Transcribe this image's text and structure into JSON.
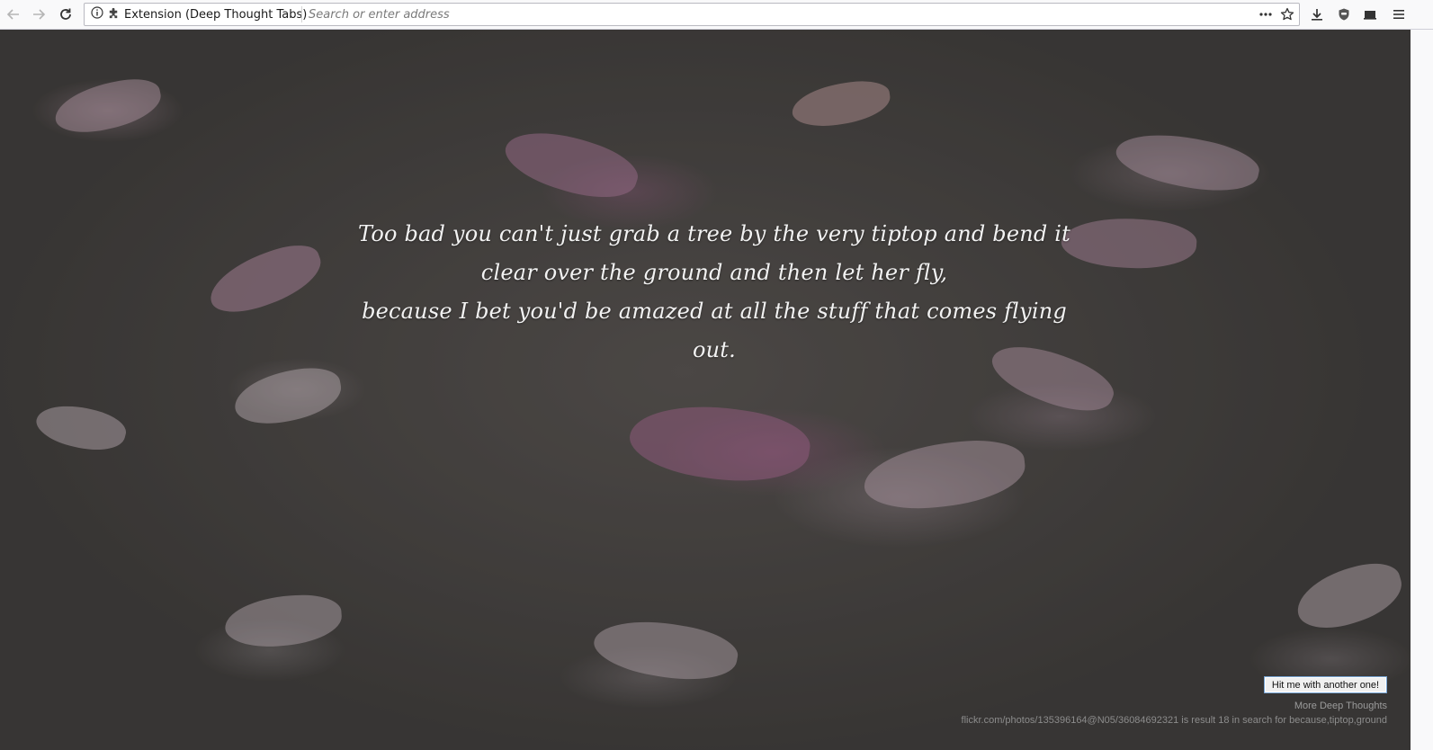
{
  "browser": {
    "back_icon": "back-arrow-icon",
    "forward_icon": "forward-arrow-icon",
    "reload_icon": "reload-icon",
    "identity_label": "Extension (Deep Thought Tabs)",
    "address_placeholder": "Search or enter address",
    "address_value": "",
    "actions": [
      "page-actions-icon",
      "bookmark-star-icon",
      "downloads-icon",
      "shield-extension-icon",
      "library-icon",
      "menu-icon"
    ]
  },
  "page": {
    "quote_lines": [
      "Too bad you can't just grab a tree by the very tiptop and bend it clear over the ground and then let her fly,",
      "because I bet you'd be amazed at all the stuff that comes flying out."
    ],
    "another_button_label": "Hit me with another one!",
    "more_link_label": "More Deep Thoughts",
    "credit_text": "flickr.com/photos/135396164@N05/36084692321 is result 18 in search for because,tiptop,ground"
  },
  "colors": {
    "chrome_bg": "#f9f9fa",
    "quote_text": "#f2f2f2",
    "footer_text": "#9b9b9b",
    "button_border": "#7aa7d6"
  }
}
